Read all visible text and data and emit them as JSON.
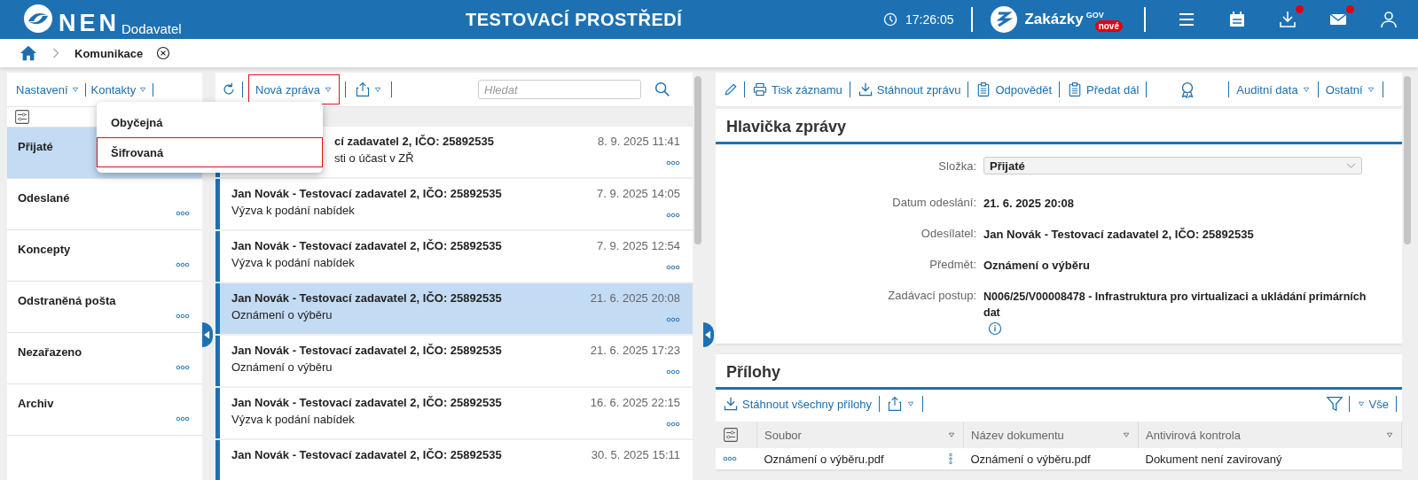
{
  "header": {
    "logo": "NEN",
    "logo_sub": "Dodavatel",
    "environment": "TESTOVACÍ PROSTŘEDÍ",
    "time": "17:26:05",
    "brand": "Zakázky",
    "brand_sup": "GOV",
    "brand_badge": "nové",
    "actions": [
      {
        "kind": "menu",
        "badge": false
      },
      {
        "kind": "calendar",
        "badge": false
      },
      {
        "kind": "download",
        "badge": true
      },
      {
        "kind": "mail",
        "badge": true
      },
      {
        "kind": "user",
        "badge": false
      }
    ]
  },
  "breadcrumb": {
    "label": "Komunikace"
  },
  "folders": {
    "toolbar": [
      "Nastavení",
      "Kontakty"
    ],
    "items": [
      {
        "label": "Přijaté",
        "selected": true,
        "more": false
      },
      {
        "label": "Odeslané",
        "selected": false,
        "more": true
      },
      {
        "label": "Koncepty",
        "selected": false,
        "more": true
      },
      {
        "label": "Odstraněná pošta",
        "selected": false,
        "more": true
      },
      {
        "label": "Nezařazeno",
        "selected": false,
        "more": true
      },
      {
        "label": "Archiv",
        "selected": false,
        "more": true
      }
    ]
  },
  "messages": {
    "new_button": {
      "label": "Nová zpráva",
      "highlighted": true
    },
    "search_placeholder": "Hledat",
    "menu": [
      {
        "label": "Obyčejná",
        "highlighted": false
      },
      {
        "label": "Šifrovaná",
        "highlighted": true
      }
    ],
    "rows": [
      {
        "sender": "cí zadavatel 2, IČO: 25892535",
        "subject": "sti o účast v ZŘ",
        "date": "8. 9. 2025 11:41",
        "selected": false,
        "partial": true
      },
      {
        "sender": "Jan Novák - Testovací zadavatel 2, IČO: 25892535",
        "subject": "Výzva k podání nabídek",
        "date": "7. 9. 2025 14:05",
        "selected": false,
        "partial": false
      },
      {
        "sender": "Jan Novák - Testovací zadavatel 2, IČO: 25892535",
        "subject": "Výzva k podání nabídek",
        "date": "7. 9. 2025 12:54",
        "selected": false,
        "partial": false
      },
      {
        "sender": "Jan Novák - Testovací zadavatel 2, IČO: 25892535",
        "subject": "Oznámení o výběru",
        "date": "21. 6. 2025 20:08",
        "selected": true,
        "partial": false
      },
      {
        "sender": "Jan Novák - Testovací zadavatel 2, IČO: 25892535",
        "subject": "Oznámení o výběru",
        "date": "21. 6. 2025 17:23",
        "selected": false,
        "partial": false
      },
      {
        "sender": "Jan Novák - Testovací zadavatel 2, IČO: 25892535",
        "subject": "Výzva k podání nabídek",
        "date": "16. 6. 2025 22:15",
        "selected": false,
        "partial": false
      },
      {
        "sender": "Jan Novák - Testovací zadavatel 2, IČO: 25892535",
        "date": "30. 5. 2025 15:11",
        "selected": false,
        "partial": false
      }
    ]
  },
  "detail": {
    "toolbar": [
      {
        "kind": "edit"
      },
      {
        "kind": "print",
        "label": "Tisk záznamu"
      },
      {
        "kind": "download",
        "label": "Stáhnout zprávu"
      },
      {
        "kind": "clipboard",
        "label": "Odpovědět"
      },
      {
        "kind": "clipboard",
        "label": "Předat dál"
      },
      {
        "kind": "award"
      },
      {
        "kind": "dropdown",
        "label": "Auditní data"
      },
      {
        "kind": "dropdown",
        "label": "Ostatní"
      }
    ],
    "header_card": {
      "title": "Hlavička zprávy",
      "fields": [
        {
          "label": "Složka:",
          "value": "Přijaté",
          "kind": "select"
        },
        {
          "label": "Datum odeslání:",
          "value": "21. 6. 2025 20:08",
          "kind": "text"
        },
        {
          "label": "Odesílatel:",
          "value": "Jan Novák - Testovací zadavatel 2, IČO: 25892535",
          "kind": "text"
        },
        {
          "label": "Předmět:",
          "value": "Oznámení o výběru",
          "kind": "text"
        },
        {
          "label": "Zadávací postup:",
          "value": "N006/25/V00008478 - Infrastruktura pro virtualizaci a ukládání primárních dat",
          "kind": "info"
        }
      ]
    },
    "attachments": {
      "title": "Přílohy",
      "download_all": "Stáhnout všechny přílohy",
      "filter": "Vše",
      "columns": [
        "Soubor",
        "Název dokumentu",
        "Antivirová kontrola"
      ],
      "rows": [
        [
          "Oznámení o výběru.pdf",
          "Oznámení o výběru.pdf",
          "Dokument není zavirovaný"
        ]
      ]
    }
  }
}
